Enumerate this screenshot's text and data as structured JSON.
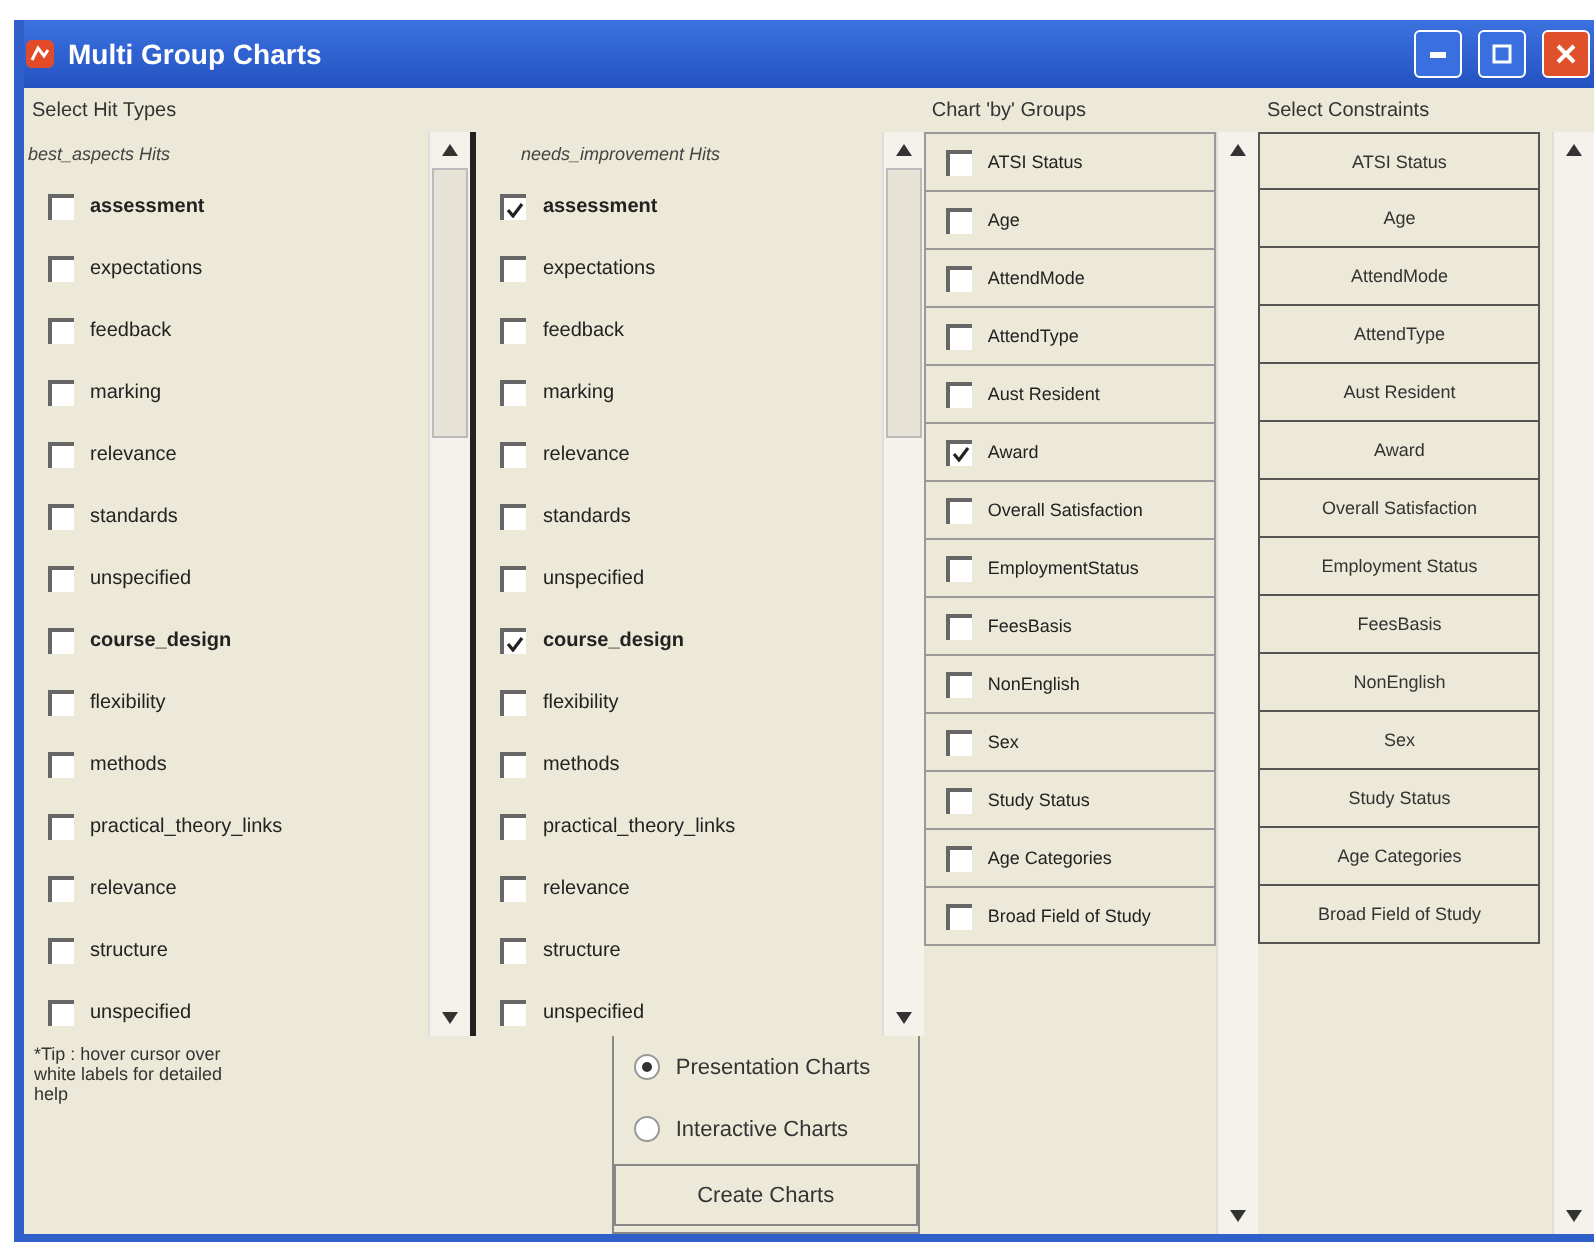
{
  "window": {
    "title": "Multi Group Charts"
  },
  "hit_types": {
    "label": "Select Hit Types",
    "lists": [
      {
        "title": "best_aspects Hits",
        "items": [
          {
            "label": "assessment",
            "bold": true,
            "checked": false
          },
          {
            "label": "expectations",
            "bold": false,
            "checked": false
          },
          {
            "label": "feedback",
            "bold": false,
            "checked": false
          },
          {
            "label": "marking",
            "bold": false,
            "checked": false
          },
          {
            "label": "relevance",
            "bold": false,
            "checked": false
          },
          {
            "label": "standards",
            "bold": false,
            "checked": false
          },
          {
            "label": "unspecified",
            "bold": false,
            "checked": false
          },
          {
            "label": "course_design",
            "bold": true,
            "checked": false
          },
          {
            "label": "flexibility",
            "bold": false,
            "checked": false
          },
          {
            "label": "methods",
            "bold": false,
            "checked": false
          },
          {
            "label": "practical_theory_links",
            "bold": false,
            "checked": false
          },
          {
            "label": "relevance",
            "bold": false,
            "checked": false
          },
          {
            "label": "structure",
            "bold": false,
            "checked": false
          },
          {
            "label": "unspecified",
            "bold": false,
            "checked": false
          }
        ]
      },
      {
        "title": "needs_improvement Hits",
        "items": [
          {
            "label": "assessment",
            "bold": true,
            "checked": true
          },
          {
            "label": "expectations",
            "bold": false,
            "checked": false
          },
          {
            "label": "feedback",
            "bold": false,
            "checked": false
          },
          {
            "label": "marking",
            "bold": false,
            "checked": false
          },
          {
            "label": "relevance",
            "bold": false,
            "checked": false
          },
          {
            "label": "standards",
            "bold": false,
            "checked": false
          },
          {
            "label": "unspecified",
            "bold": false,
            "checked": false
          },
          {
            "label": "course_design",
            "bold": true,
            "checked": true
          },
          {
            "label": "flexibility",
            "bold": false,
            "checked": false
          },
          {
            "label": "methods",
            "bold": false,
            "checked": false
          },
          {
            "label": "practical_theory_links",
            "bold": false,
            "checked": false
          },
          {
            "label": "relevance",
            "bold": false,
            "checked": false
          },
          {
            "label": "structure",
            "bold": false,
            "checked": false
          },
          {
            "label": "unspecified",
            "bold": false,
            "checked": false
          }
        ]
      }
    ]
  },
  "tip": "*Tip : hover cursor over white labels for detailed help",
  "chart_type": {
    "options": [
      {
        "label": "Presentation Charts",
        "selected": true
      },
      {
        "label": "Interactive Charts",
        "selected": false
      }
    ],
    "button": "Create Charts"
  },
  "groups": {
    "label": "Chart 'by' Groups",
    "items": [
      {
        "label": "ATSI Status",
        "checked": false
      },
      {
        "label": "Age",
        "checked": false
      },
      {
        "label": "AttendMode",
        "checked": false
      },
      {
        "label": "AttendType",
        "checked": false
      },
      {
        "label": "Aust Resident",
        "checked": false
      },
      {
        "label": "Award",
        "checked": true
      },
      {
        "label": "Overall Satisfaction",
        "checked": false
      },
      {
        "label": "EmploymentStatus",
        "checked": false
      },
      {
        "label": "FeesBasis",
        "checked": false
      },
      {
        "label": "NonEnglish",
        "checked": false
      },
      {
        "label": "Sex",
        "checked": false
      },
      {
        "label": "Study Status",
        "checked": false
      },
      {
        "label": "Age Categories",
        "checked": false
      },
      {
        "label": "Broad Field of Study",
        "checked": false
      }
    ]
  },
  "constraints": {
    "label": "Select Constraints",
    "items": [
      "ATSI Status",
      "Age",
      "AttendMode",
      "AttendType",
      "Aust Resident",
      "Award",
      "Overall Satisfaction",
      "Employment Status",
      "FeesBasis",
      "NonEnglish",
      "Sex",
      "Study Status",
      "Age Categories",
      "Broad Field of Study"
    ]
  }
}
